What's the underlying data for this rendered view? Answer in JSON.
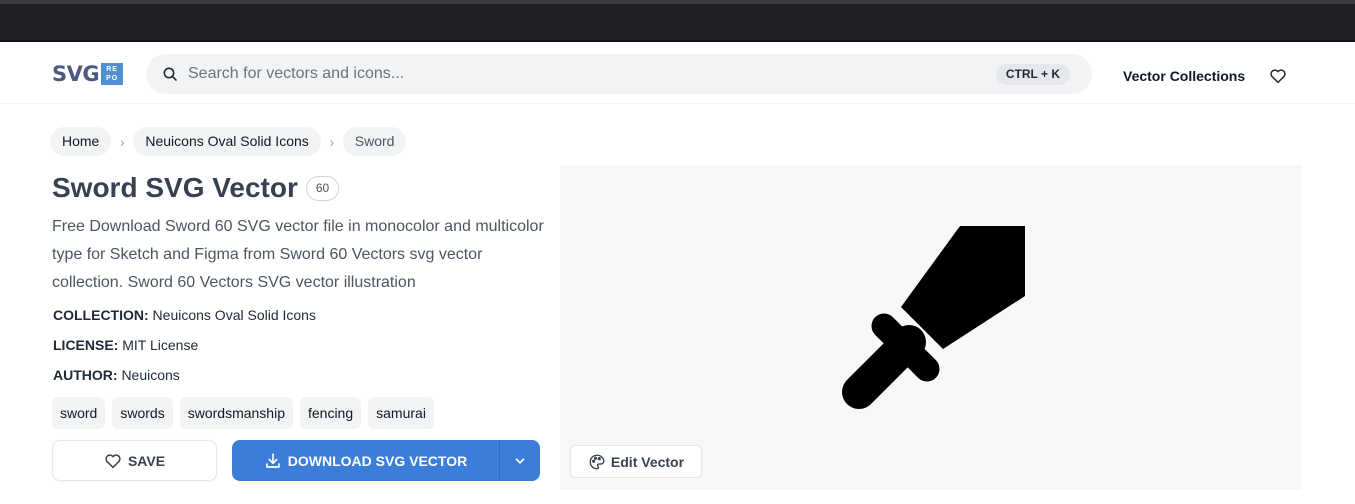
{
  "logo": {
    "text": "SVG",
    "box_line1": "RE",
    "box_line2": "PO"
  },
  "search": {
    "placeholder": "Search for vectors and icons...",
    "shortcut": "CTRL + K"
  },
  "nav": {
    "collections_label": "Vector Collections"
  },
  "breadcrumb": [
    "Home",
    "Neuicons Oval Solid Icons",
    "Sword"
  ],
  "title": "Sword SVG Vector",
  "count_badge": "60",
  "description": "Free Download Sword 60 SVG vector file in monocolor and multicolor type for Sketch and Figma from Sword 60 Vectors svg vector collection. Sword 60 Vectors SVG vector illustration",
  "meta": {
    "collection_label": "COLLECTION:",
    "collection_value": "Neuicons Oval Solid Icons",
    "license_label": "LICENSE:",
    "license_value": "MIT License",
    "author_label": "AUTHOR:",
    "author_value": "Neuicons"
  },
  "tags": [
    "sword",
    "swords",
    "swordsmanship",
    "fencing",
    "samurai"
  ],
  "buttons": {
    "save": "SAVE",
    "download": "DOWNLOAD SVG VECTOR",
    "edit": "Edit Vector"
  },
  "colors": {
    "brand": "#4a5a80",
    "accent": "#3b7dd8",
    "logo_box": "#4f8fd6"
  },
  "icons": [
    "search-icon",
    "heart-icon",
    "chevron-right-icon",
    "download-icon",
    "chevron-down-icon",
    "palette-icon",
    "sword-icon"
  ]
}
